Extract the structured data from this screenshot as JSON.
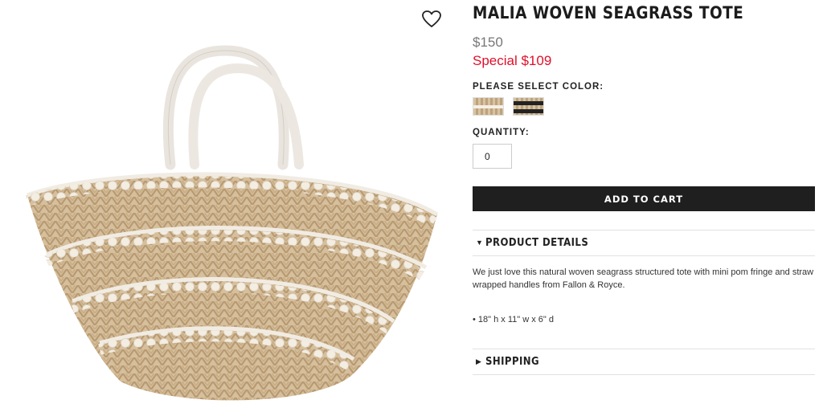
{
  "product": {
    "title": "MALIA WOVEN SEAGRASS TOTE",
    "price_original": "$150",
    "price_special": "Special $109"
  },
  "color_select": {
    "label": "PLEASE SELECT COLOR:",
    "options": [
      {
        "name": "natural"
      },
      {
        "name": "black stripe"
      }
    ]
  },
  "quantity": {
    "label": "QUANTITY:",
    "value": "0"
  },
  "cart": {
    "button_label": "ADD TO CART"
  },
  "details": {
    "header": "PRODUCT DETAILS",
    "expanded": true,
    "description": "We just love this natural woven seagrass structured tote with mini pom fringe and straw wrapped handles from Fallon & Royce.",
    "dimensions": "• 18\" h x 11\" w x 6\" d"
  },
  "shipping": {
    "header": "SHIPPING",
    "expanded": false
  },
  "icons": {
    "wishlist": "heart-icon",
    "details_arrow": "triangle-down-icon",
    "shipping_arrow": "triangle-right-icon"
  },
  "colors": {
    "special_price": "#e0102a",
    "button_bg": "#1f1f1f"
  }
}
